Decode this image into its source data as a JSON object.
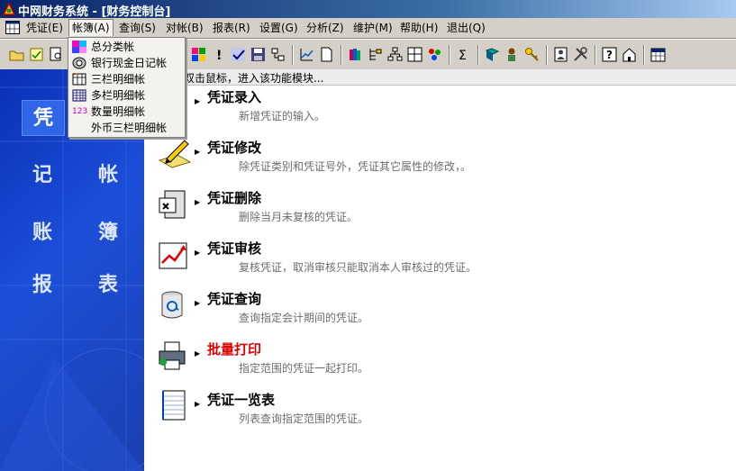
{
  "window": {
    "title": "中网财务系统 - [财务控制台]"
  },
  "menubar": {
    "items": [
      {
        "label": "凭证(E)"
      },
      {
        "label": "帐簿(A)"
      },
      {
        "label": "查询(S)"
      },
      {
        "label": "对帐(B)"
      },
      {
        "label": "报表(R)"
      },
      {
        "label": "设置(G)"
      },
      {
        "label": "分析(Z)"
      },
      {
        "label": "维护(M)"
      },
      {
        "label": "帮助(H)"
      },
      {
        "label": "退出(Q)"
      }
    ]
  },
  "dropdown": {
    "items": [
      {
        "label": "总分类帐",
        "icon": "grid-colored-icon"
      },
      {
        "label": "银行现金日记帐",
        "icon": "coin-icon"
      },
      {
        "label": "三栏明细帐",
        "icon": "ledger-icon"
      },
      {
        "label": "多栏明细帐",
        "icon": "multi-column-grid-icon"
      },
      {
        "label": "数量明细帐",
        "icon_text": "123",
        "icon": "number-icon"
      },
      {
        "label": "外币三栏明细帐",
        "icon": ""
      }
    ]
  },
  "hint": "双击鼠标，进入该功能模块...",
  "left_nav": {
    "items": [
      {
        "label": "凭"
      },
      {
        "label": "记"
      },
      {
        "label": "帐"
      },
      {
        "label": "账"
      },
      {
        "label": "簿"
      },
      {
        "label": "报"
      },
      {
        "label": "表"
      }
    ]
  },
  "functions": [
    {
      "title": "凭证录入",
      "desc": "新增凭证的输入。",
      "icon": "document-entry-icon"
    },
    {
      "title": "凭证修改",
      "desc": "除凭证类别和凭证号外，凭证其它属性的修改，。",
      "icon": "pencil-edit-icon"
    },
    {
      "title": "凭证删除",
      "desc": "删除当月未复核的凭证。",
      "icon": "delete-voucher-icon"
    },
    {
      "title": "凭证审核",
      "desc": "复核凭证，取消审核只能取消本人审核过的凭证。",
      "icon": "audit-chart-icon"
    },
    {
      "title": "凭证查询",
      "desc": "查询指定会计期间的凭证。",
      "icon": "query-bin-icon"
    },
    {
      "title": "批量打印",
      "desc": "指定范围的凭证一起打印。",
      "icon": "printer-icon",
      "highlight": true
    },
    {
      "title": "凭证一览表",
      "desc": "列表查询指定范围的凭证。",
      "icon": "list-notebook-icon"
    }
  ],
  "colors": {
    "title_bar": "#0a246a",
    "left_panel": "#1c4fd8",
    "highlight_text": "#e00000",
    "desc_text": "#6c6c6c"
  }
}
